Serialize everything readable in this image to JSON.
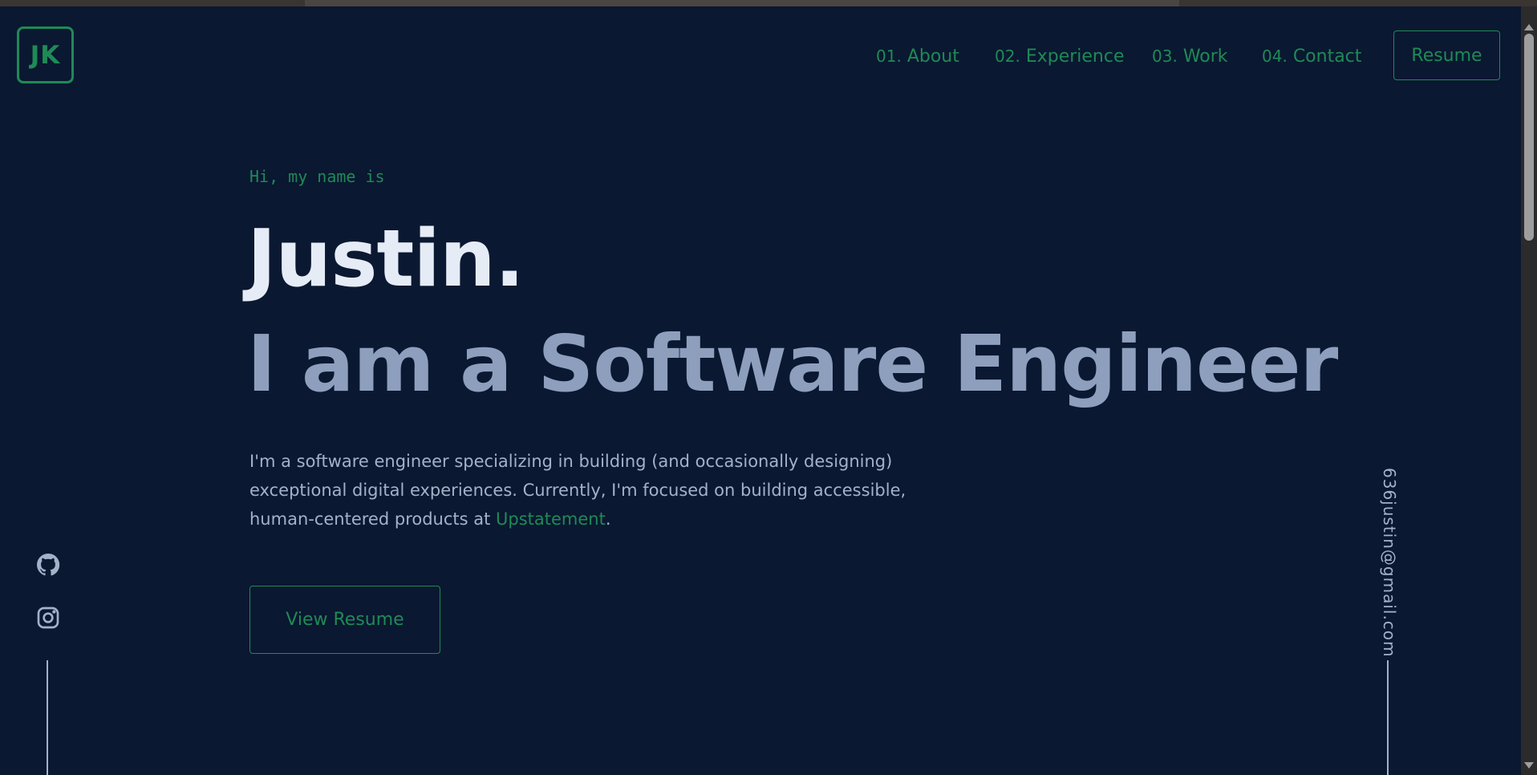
{
  "logo": {
    "text": "JK"
  },
  "nav": {
    "items": [
      {
        "num": "01.",
        "label": "About"
      },
      {
        "num": "02.",
        "label": "Experience"
      },
      {
        "num": "03.",
        "label": "Work"
      },
      {
        "num": "04.",
        "label": "Contact"
      }
    ],
    "resume_label": "Resume"
  },
  "hero": {
    "greeting": "Hi, my name is",
    "name": "Justin.",
    "role": "I am a Software Engineer",
    "bio_1": "I'm a software engineer specializing in building (and occasionally designing) exceptional digital experiences. Currently, I'm focused on building accessible, human-centered products at ",
    "bio_link": "Upstatement",
    "bio_end": ".",
    "button_label": "View Resume"
  },
  "social": {
    "icons": [
      "github-icon",
      "instagram-icon"
    ]
  },
  "email": "636justin@gmail.com",
  "colors": {
    "background": "#0a1831",
    "accent": "#1f8a56",
    "heading": "#e6ecf6",
    "subheading": "#8e9fbe",
    "body": "#a3b1c9"
  }
}
